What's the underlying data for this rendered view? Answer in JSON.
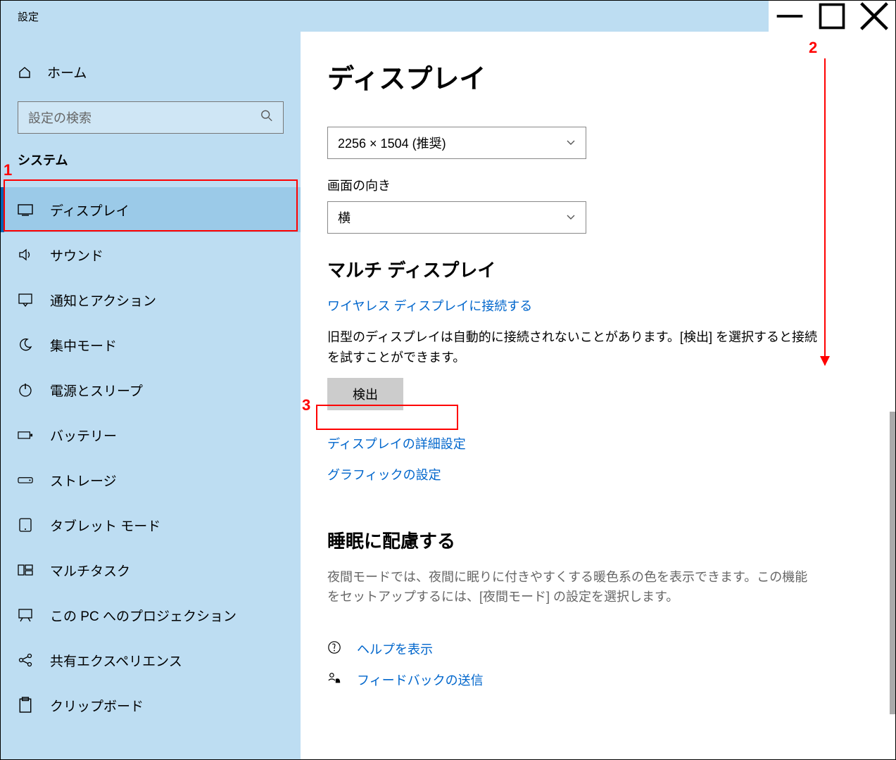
{
  "window": {
    "title": "設定",
    "min": "—",
    "max": "☐",
    "close": "✕"
  },
  "sidebar": {
    "home": "ホーム",
    "search_placeholder": "設定の検索",
    "category": "システム",
    "items": [
      {
        "label": "ディスプレイ"
      },
      {
        "label": "サウンド"
      },
      {
        "label": "通知とアクション"
      },
      {
        "label": "集中モード"
      },
      {
        "label": "電源とスリープ"
      },
      {
        "label": "バッテリー"
      },
      {
        "label": "ストレージ"
      },
      {
        "label": "タブレット モード"
      },
      {
        "label": "マルチタスク"
      },
      {
        "label": "この PC へのプロジェクション"
      },
      {
        "label": "共有エクスペリエンス"
      },
      {
        "label": "クリップボード"
      }
    ]
  },
  "main": {
    "heading": "ディスプレイ",
    "cutoff_label": " ",
    "resolution_value": "2256 × 1504 (推奨)",
    "orientation_label": "画面の向き",
    "orientation_value": "横",
    "multi_heading": "マルチ ディスプレイ",
    "wireless_link": "ワイヤレス ディスプレイに接続する",
    "detect_desc": "旧型のディスプレイは自動的に接続されないことがあります。[検出] を選択すると接続を試すことができます。",
    "detect_button": "検出",
    "advanced_link": "ディスプレイの詳細設定",
    "graphics_link": "グラフィックの設定",
    "sleep_heading": "睡眠に配慮する",
    "sleep_desc": "夜間モードでは、夜間に眠りに付きやすくする暖色系の色を表示できます。この機能をセットアップするには、[夜間モード] の設定を選択します。",
    "help_link": "ヘルプを表示",
    "feedback_link": "フィードバックの送信"
  },
  "annotations": {
    "n1": "1",
    "n2": "2",
    "n3": "3"
  }
}
